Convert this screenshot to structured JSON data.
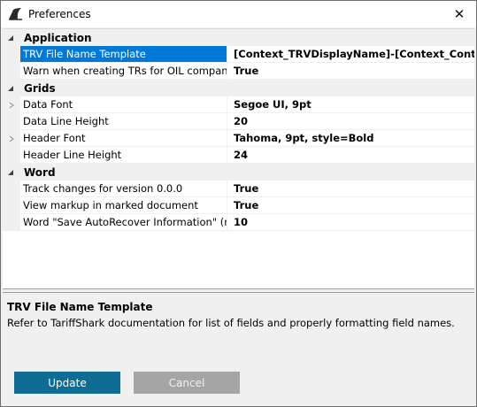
{
  "window": {
    "title": "Preferences",
    "close_label": "✕"
  },
  "grid": {
    "categories": [
      {
        "label": "Application",
        "expanded": true,
        "properties": [
          {
            "name": "TRV File Name Template",
            "value": "[Context_TRVDisplayName]-[Context_ContentType]",
            "selected": true,
            "expandable": false
          },
          {
            "name": "Warn when creating TRs for OIL companies",
            "value": "True",
            "selected": false,
            "expandable": false
          }
        ]
      },
      {
        "label": "Grids",
        "expanded": true,
        "properties": [
          {
            "name": "Data Font",
            "value": "Segoe UI, 9pt",
            "selected": false,
            "expandable": true
          },
          {
            "name": "Data Line Height",
            "value": "20",
            "selected": false,
            "expandable": false
          },
          {
            "name": "Header Font",
            "value": "Tahoma, 9pt, style=Bold",
            "selected": false,
            "expandable": true
          },
          {
            "name": "Header Line Height",
            "value": "24",
            "selected": false,
            "expandable": false
          }
        ]
      },
      {
        "label": "Word",
        "expanded": true,
        "properties": [
          {
            "name": "Track changes for version 0.0.0",
            "value": "True",
            "selected": false,
            "expandable": false
          },
          {
            "name": "View markup in marked document",
            "value": "True",
            "selected": false,
            "expandable": false
          },
          {
            "name": "Word \"Save AutoRecover Information\" (minutes)",
            "value": "10",
            "selected": false,
            "expandable": false
          }
        ]
      }
    ]
  },
  "description": {
    "title": "TRV File Name Template",
    "text": "Refer to TariffShark documentation for list of fields and properly formatting field names."
  },
  "buttons": {
    "update_label": "Update",
    "cancel_label": "Cancel",
    "cancel_enabled": false
  },
  "colors": {
    "selection": "#0078d7",
    "primary_button": "#0e6c95",
    "disabled_button": "#a5a5a5"
  }
}
